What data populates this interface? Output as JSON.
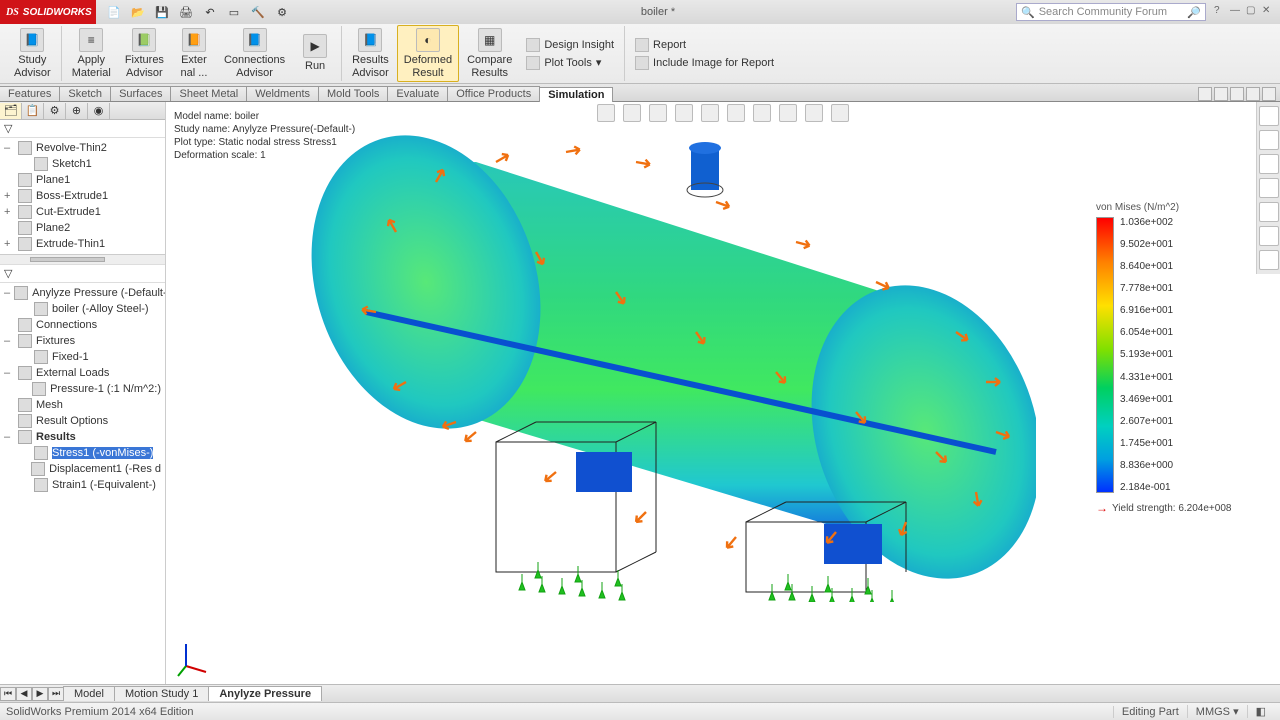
{
  "app": {
    "brand_prefix": "DS",
    "brand": "SOLIDWORKS",
    "document_title": "boiler *",
    "search_placeholder": "Search Community Forum",
    "edition": "SolidWorks Premium 2014 x64 Edition"
  },
  "ribbon": {
    "study_advisor": "Study\nAdvisor",
    "apply_material": "Apply\nMaterial",
    "fixtures_advisor": "Fixtures\nAdvisor",
    "external_loads": "Exter\nnal ...",
    "connections_advisor": "Connections\nAdvisor",
    "run": "Run",
    "results_advisor": "Results\nAdvisor",
    "deformed_result": "Deformed\nResult",
    "compare_results": "Compare\nResults",
    "design_insight": "Design Insight",
    "plot_tools": "Plot Tools",
    "report": "Report",
    "include_image": "Include Image for Report"
  },
  "cmd_tabs": [
    "Features",
    "Sketch",
    "Surfaces",
    "Sheet Metal",
    "Weldments",
    "Mold Tools",
    "Evaluate",
    "Office Products",
    "Simulation"
  ],
  "cmd_tabs_active": 8,
  "feature_tree": [
    {
      "label": "Revolve-Thin2",
      "twist": "–",
      "indent": 0,
      "icon": "revolve-icon"
    },
    {
      "label": "Sketch1",
      "twist": "",
      "indent": 1,
      "icon": "sketch-icon"
    },
    {
      "label": "Plane1",
      "twist": "",
      "indent": 0,
      "icon": "plane-icon"
    },
    {
      "label": "Boss-Extrude1",
      "twist": "+",
      "indent": 0,
      "icon": "extrude-icon"
    },
    {
      "label": "Cut-Extrude1",
      "twist": "+",
      "indent": 0,
      "icon": "cut-icon"
    },
    {
      "label": "Plane2",
      "twist": "",
      "indent": 0,
      "icon": "plane-icon"
    },
    {
      "label": "Extrude-Thin1",
      "twist": "+",
      "indent": 0,
      "icon": "extrude-icon"
    }
  ],
  "sim_tree": [
    {
      "label": "Anylyze Pressure (-Default-)",
      "twist": "–",
      "indent": 0,
      "icon": "study-icon"
    },
    {
      "label": "boiler (-Alloy Steel-)",
      "twist": "",
      "indent": 1,
      "icon": "part-icon"
    },
    {
      "label": "Connections",
      "twist": "",
      "indent": 0,
      "icon": "connections-icon"
    },
    {
      "label": "Fixtures",
      "twist": "–",
      "indent": 0,
      "icon": "fixtures-icon"
    },
    {
      "label": "Fixed-1",
      "twist": "",
      "indent": 1,
      "icon": "fixed-icon"
    },
    {
      "label": "External Loads",
      "twist": "–",
      "indent": 0,
      "icon": "loads-icon"
    },
    {
      "label": "Pressure-1 (:1 N/m^2:)",
      "twist": "",
      "indent": 1,
      "icon": "pressure-icon"
    },
    {
      "label": "Mesh",
      "twist": "",
      "indent": 0,
      "icon": "mesh-icon"
    },
    {
      "label": "Result Options",
      "twist": "",
      "indent": 0,
      "icon": "result-options-icon"
    },
    {
      "label": "Results",
      "twist": "–",
      "indent": 0,
      "icon": "results-folder-icon",
      "bold": true
    },
    {
      "label": "Stress1 (-vonMises-)",
      "twist": "",
      "indent": 1,
      "icon": "plot-icon",
      "selected": true
    },
    {
      "label": "Displacement1 (-Res d",
      "twist": "",
      "indent": 1,
      "icon": "plot-icon"
    },
    {
      "label": "Strain1 (-Equivalent-)",
      "twist": "",
      "indent": 1,
      "icon": "plot-icon"
    }
  ],
  "plot_info": {
    "l1": "Model name: boiler",
    "l2": "Study name: Anylyze Pressure(-Default-)",
    "l3": "Plot type: Static nodal stress Stress1",
    "l4": "Deformation scale: 1"
  },
  "legend": {
    "title": "von Mises (N/m^2)",
    "ticks": [
      "1.036e+002",
      "9.502e+001",
      "8.640e+001",
      "7.778e+001",
      "6.916e+001",
      "6.054e+001",
      "5.193e+001",
      "4.331e+001",
      "3.469e+001",
      "2.607e+001",
      "1.745e+001",
      "8.836e+000",
      "2.184e-001"
    ],
    "yield": "Yield strength: 6.204e+008"
  },
  "view_tabs": {
    "items": [
      "Model",
      "Motion Study 1",
      "Anylyze Pressure"
    ],
    "active": 2
  },
  "status": {
    "mode": "Editing Part",
    "units": "MMGS"
  }
}
